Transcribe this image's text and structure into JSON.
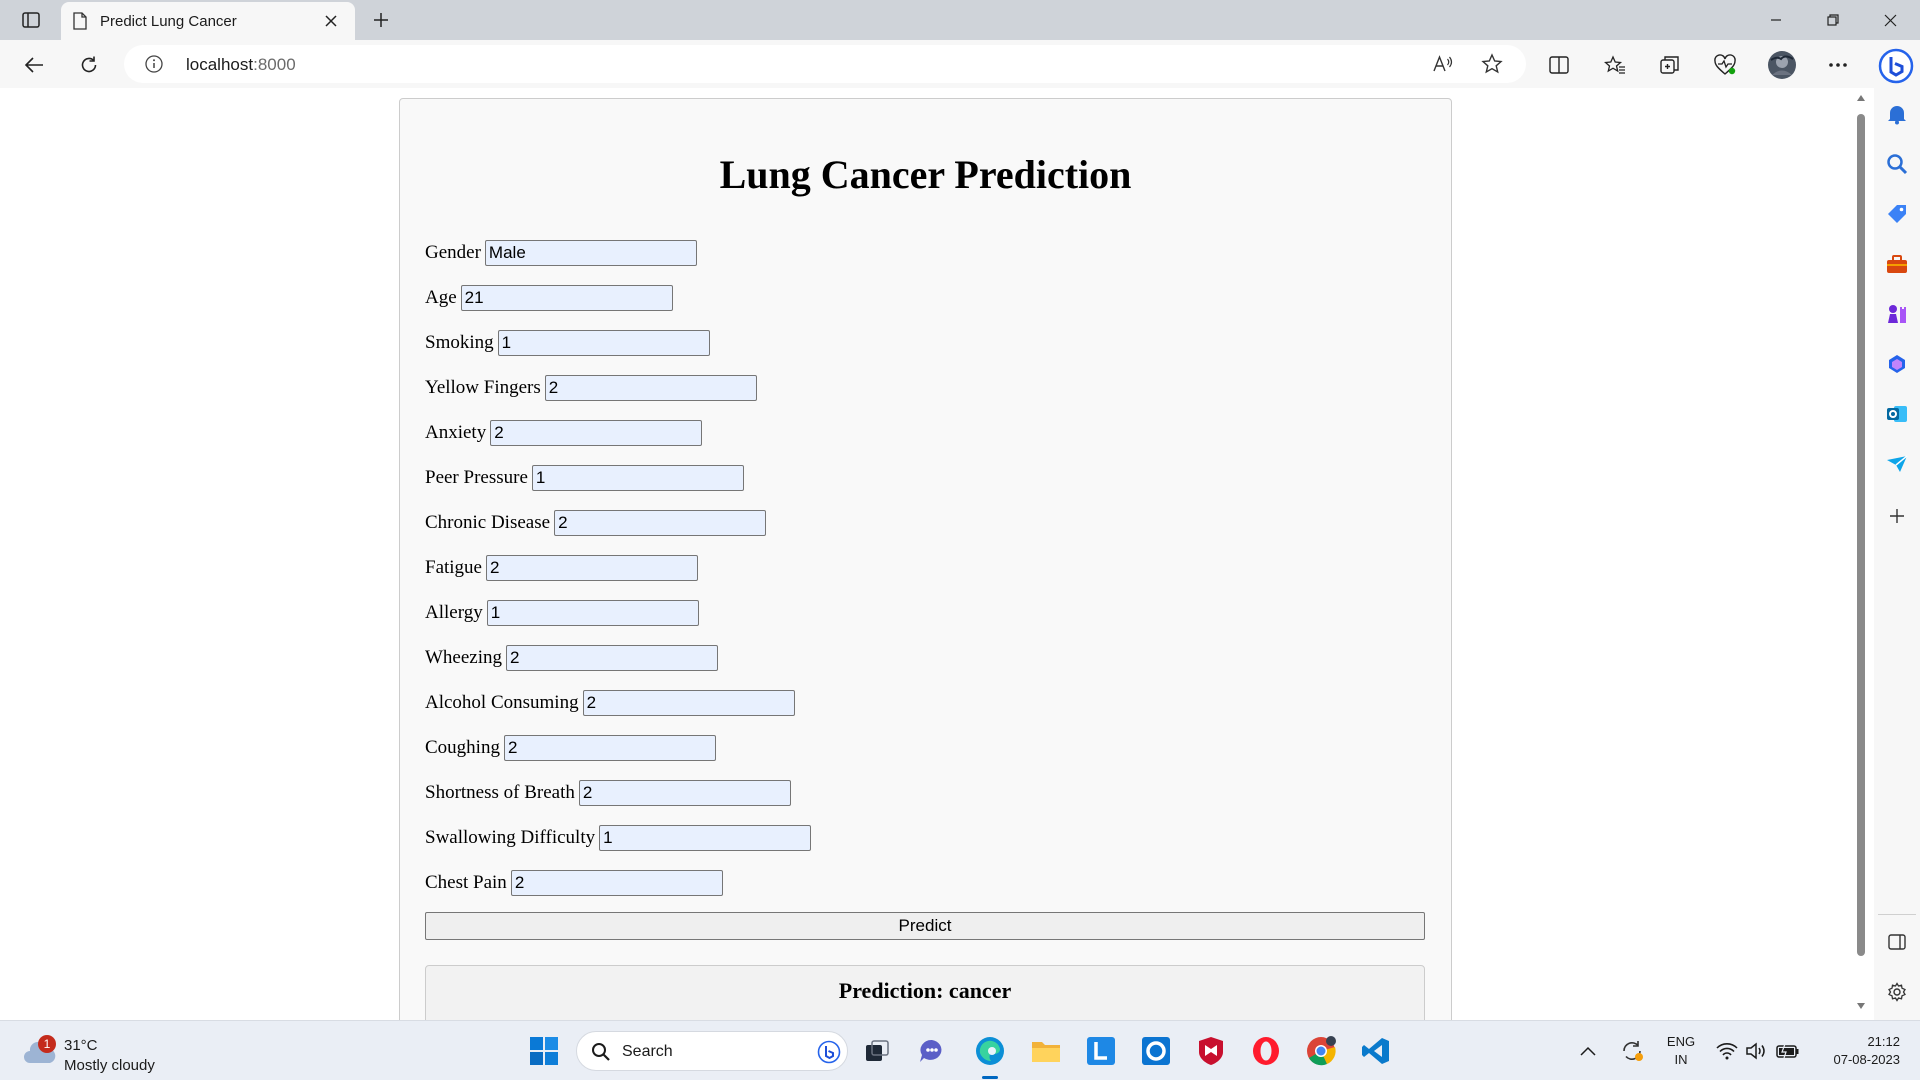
{
  "browser": {
    "tab_title": "Predict Lung Cancer",
    "url_host": "localhost",
    "url_port": ":8000"
  },
  "page": {
    "title": "Lung Cancer Prediction",
    "fields": [
      {
        "label": "Gender",
        "value": "Male"
      },
      {
        "label": "Age",
        "value": "21"
      },
      {
        "label": "Smoking",
        "value": "1"
      },
      {
        "label": "Yellow Fingers",
        "value": "2"
      },
      {
        "label": "Anxiety",
        "value": "2"
      },
      {
        "label": "Peer Pressure",
        "value": "1"
      },
      {
        "label": "Chronic Disease",
        "value": "2"
      },
      {
        "label": "Fatigue",
        "value": "2"
      },
      {
        "label": "Allergy",
        "value": "1"
      },
      {
        "label": "Wheezing",
        "value": "2"
      },
      {
        "label": "Alcohol Consuming",
        "value": "2"
      },
      {
        "label": "Coughing",
        "value": "2"
      },
      {
        "label": "Shortness of Breath",
        "value": "2"
      },
      {
        "label": "Swallowing Difficulty",
        "value": "1"
      },
      {
        "label": "Chest Pain",
        "value": "2"
      }
    ],
    "predict_label": "Predict",
    "result_text": "Prediction: cancer"
  },
  "taskbar": {
    "weather_badge": "1",
    "weather_temp": "31°C",
    "weather_desc": "Mostly cloudy",
    "search_label": "Search",
    "lang_top": "ENG",
    "lang_bottom": "IN",
    "time": "21:12",
    "date": "07-08-2023"
  },
  "colors": {
    "accent": "#0067c0",
    "input_bg": "#e8f0fe"
  }
}
